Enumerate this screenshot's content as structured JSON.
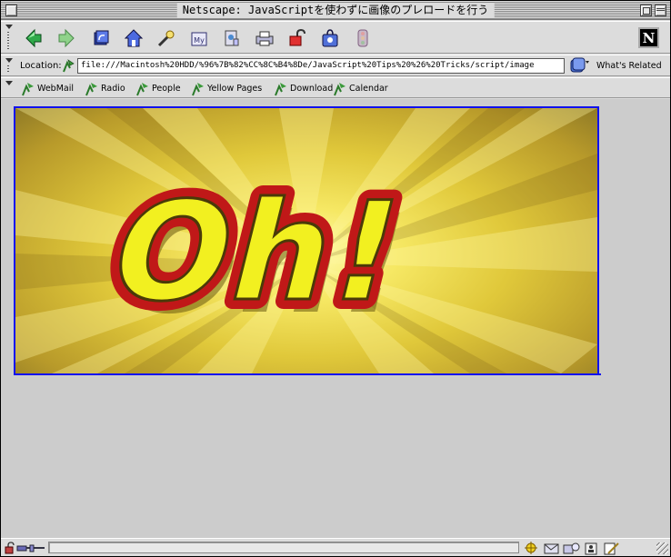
{
  "window": {
    "title": "Netscape: JavaScriptを使わずに画像のプレロードを行う"
  },
  "nav_toolbar": {
    "buttons": [
      {
        "name": "back",
        "icon": "back-arrow-icon"
      },
      {
        "name": "forward",
        "icon": "forward-arrow-icon"
      },
      {
        "name": "reload",
        "icon": "reload-icon"
      },
      {
        "name": "home",
        "icon": "home-icon"
      },
      {
        "name": "search",
        "icon": "search-icon"
      },
      {
        "name": "my-netscape",
        "icon": "my-netscape-icon"
      },
      {
        "name": "images",
        "icon": "images-icon"
      },
      {
        "name": "print",
        "icon": "print-icon"
      },
      {
        "name": "security",
        "icon": "security-lock-icon"
      },
      {
        "name": "shop",
        "icon": "shop-icon"
      },
      {
        "name": "stop",
        "icon": "stop-icon"
      }
    ],
    "logo_letter": "N"
  },
  "location_bar": {
    "label": "Location:",
    "url": "file:///Macintosh%20HDD/%96%7B%82%CC%8C%B4%8De/JavaScript%20Tips%20%26%20Tricks/script/image",
    "related_label": "What's Related"
  },
  "personal_toolbar": {
    "items": [
      "WebMail",
      "Radio",
      "People",
      "Yellow Pages",
      "Download",
      "Calendar"
    ]
  },
  "content": {
    "banner_text": "Oh!"
  },
  "status_bar": {
    "progress": 0.0
  },
  "colors": {
    "window_bg": "#dcdcdc",
    "content_bg": "#cccccc",
    "link_border": "#1010ee",
    "banner_letter_fill": "#f2f020",
    "banner_letter_outline": "#c01818"
  }
}
